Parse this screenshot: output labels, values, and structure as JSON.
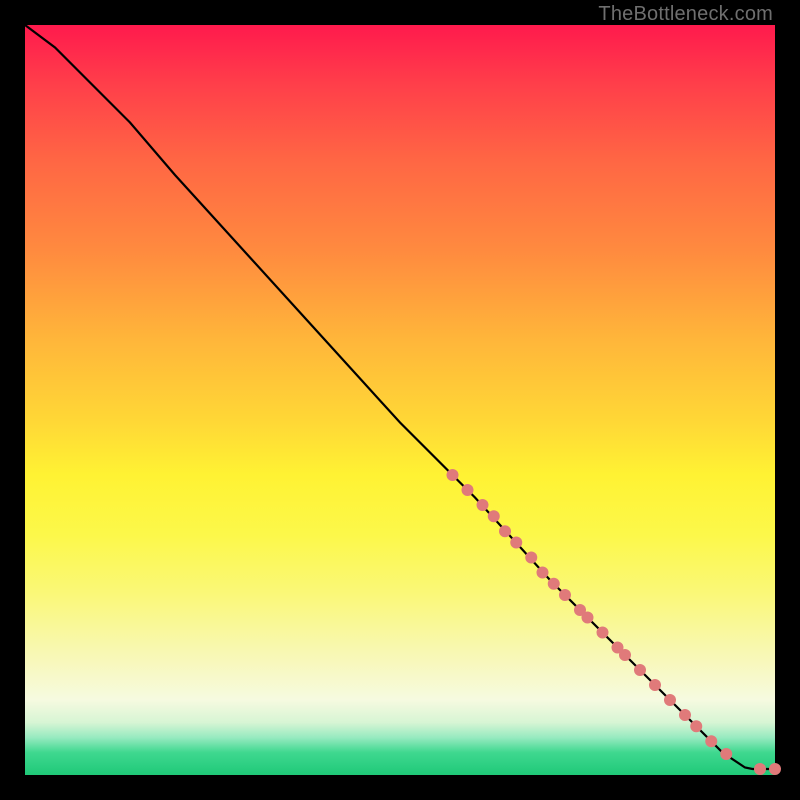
{
  "credit": "TheBottleneck.com",
  "chart_data": {
    "type": "line",
    "title": "",
    "xlabel": "",
    "ylabel": "",
    "xlim": [
      0,
      100
    ],
    "ylim": [
      0,
      100
    ],
    "grid": false,
    "legend": false,
    "curve": {
      "description": "monotone decreasing curve from top-left to bottom-right, near-linear after initial shoulder",
      "x": [
        0,
        4,
        8,
        14,
        20,
        30,
        40,
        50,
        60,
        70,
        80,
        88,
        93,
        96,
        97,
        100
      ],
      "y": [
        100,
        97,
        93,
        87,
        80,
        69,
        58,
        47,
        37,
        26,
        16,
        8,
        3,
        1,
        0.8,
        0.8
      ]
    },
    "markers": {
      "color": "#e07a7a",
      "approx_radius_px": 6,
      "points": [
        {
          "x": 57,
          "y": 40
        },
        {
          "x": 59,
          "y": 38
        },
        {
          "x": 61,
          "y": 36
        },
        {
          "x": 62.5,
          "y": 34.5
        },
        {
          "x": 64,
          "y": 32.5
        },
        {
          "x": 65.5,
          "y": 31
        },
        {
          "x": 67.5,
          "y": 29
        },
        {
          "x": 69,
          "y": 27
        },
        {
          "x": 70.5,
          "y": 25.5
        },
        {
          "x": 72,
          "y": 24
        },
        {
          "x": 74,
          "y": 22
        },
        {
          "x": 75,
          "y": 21
        },
        {
          "x": 77,
          "y": 19
        },
        {
          "x": 79,
          "y": 17
        },
        {
          "x": 80,
          "y": 16
        },
        {
          "x": 82,
          "y": 14
        },
        {
          "x": 84,
          "y": 12
        },
        {
          "x": 86,
          "y": 10
        },
        {
          "x": 88,
          "y": 8
        },
        {
          "x": 89.5,
          "y": 6.5
        },
        {
          "x": 91.5,
          "y": 4.5
        },
        {
          "x": 93.5,
          "y": 2.8
        },
        {
          "x": 98,
          "y": 0.8
        },
        {
          "x": 100,
          "y": 0.8
        }
      ]
    }
  }
}
